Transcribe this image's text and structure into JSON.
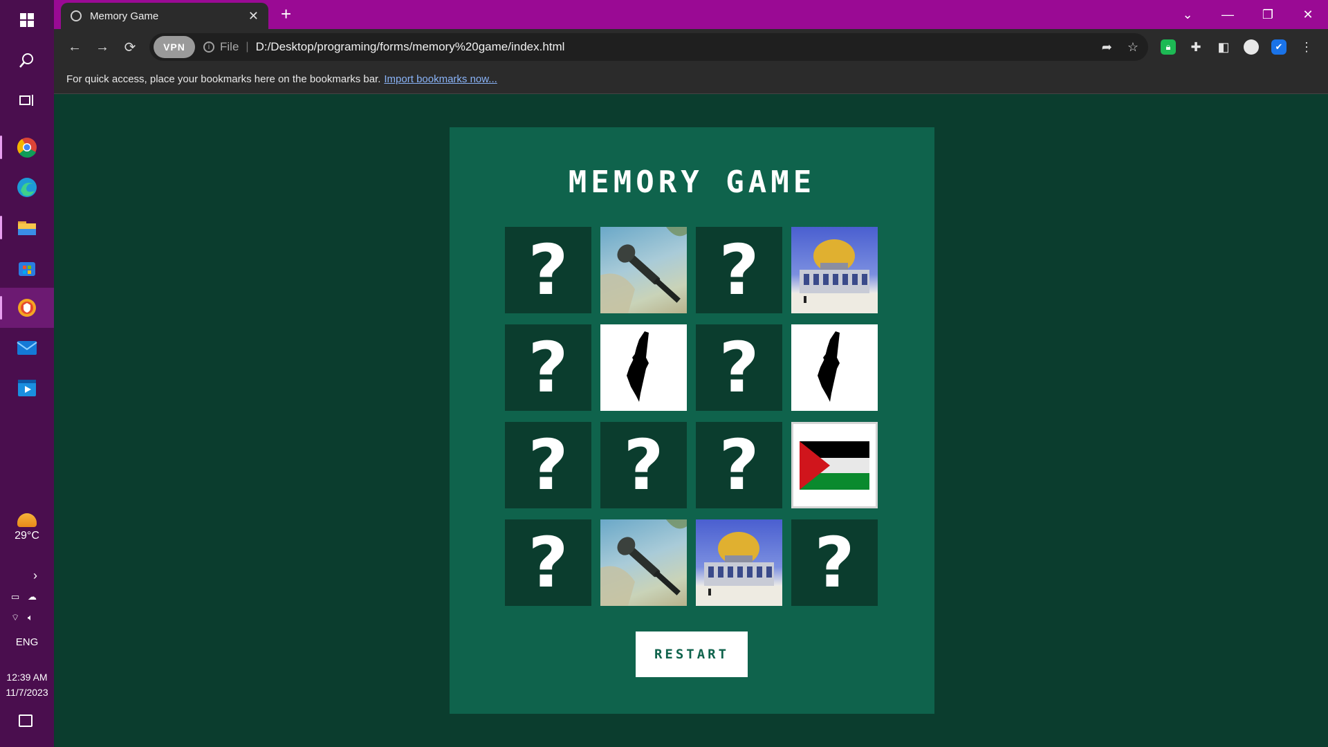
{
  "taskbar": {
    "apps": [
      {
        "name": "start-icon"
      },
      {
        "name": "search-icon"
      },
      {
        "name": "task-view-icon"
      },
      {
        "name": "chrome-icon"
      },
      {
        "name": "edge-icon"
      },
      {
        "name": "file-explorer-icon"
      },
      {
        "name": "store-icon"
      },
      {
        "name": "vpn-browser-icon"
      },
      {
        "name": "mail-icon"
      },
      {
        "name": "media-icon"
      }
    ],
    "weather_temp": "29°C",
    "language": "ENG",
    "time": "12:39 AM",
    "date": "11/7/2023"
  },
  "browser": {
    "tab_title": "Memory Game",
    "vpn_label": "VPN",
    "file_label": "File",
    "url": "D:/Desktop/programing/forms/memory%20game/index.html",
    "bookmarks_text": "For quick access, place your bookmarks here on the bookmarks bar.",
    "bookmarks_link": "Import bookmarks now..."
  },
  "game": {
    "title": "MEMORY GAME",
    "restart_label": "RESTART",
    "hidden_symbol": "?",
    "cards": [
      {
        "state": "hidden"
      },
      {
        "state": "revealed",
        "image": "rifle"
      },
      {
        "state": "hidden"
      },
      {
        "state": "revealed",
        "image": "dome"
      },
      {
        "state": "hidden"
      },
      {
        "state": "revealed",
        "image": "map"
      },
      {
        "state": "hidden"
      },
      {
        "state": "revealed",
        "image": "map"
      },
      {
        "state": "hidden"
      },
      {
        "state": "hidden"
      },
      {
        "state": "hidden"
      },
      {
        "state": "revealed",
        "image": "flag"
      },
      {
        "state": "hidden"
      },
      {
        "state": "revealed",
        "image": "rifle"
      },
      {
        "state": "revealed",
        "image": "dome"
      },
      {
        "state": "hidden"
      }
    ]
  },
  "colors": {
    "titlebar": "#9a0a94",
    "taskbar": "#4a0e4e",
    "page_background": "#0b3d2e",
    "board_background": "#0f634c",
    "card_back": "#0b3d2e",
    "flag_black": "#000000",
    "flag_white": "#ffffff",
    "flag_green": "#0a8a2e",
    "flag_red": "#d0151c",
    "gold": "#e0b030"
  }
}
